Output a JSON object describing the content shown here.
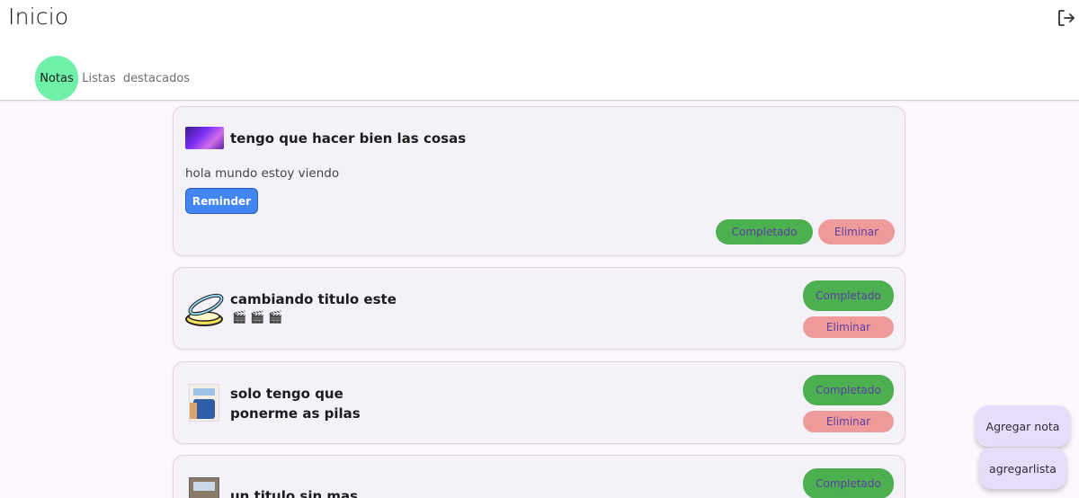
{
  "header": {
    "title": "Inicio",
    "tabs": [
      "Notas",
      "Listas",
      "destacados"
    ]
  },
  "notes": [
    {
      "title": "tengo que hacer bien las cosas",
      "body": "hola mundo estoy viendo",
      "reminder_label": "Reminder",
      "complete_label": "Completado",
      "delete_label": "Eliminar"
    },
    {
      "title": "cambiando titulo este",
      "emojis": "🎬🎬🎬",
      "complete_label": "Completado",
      "delete_label": "Eliminar"
    },
    {
      "title_line1": "solo tengo que",
      "title_line2": "ponerme as pilas",
      "complete_label": "Completado",
      "delete_label": "Eliminar"
    },
    {
      "title": "un titulo sin mas",
      "complete_label": "Completado"
    }
  ],
  "fab": {
    "add_note": "Agregar nota",
    "add_list": "agregarlista"
  },
  "colors": {
    "tab_active": "#6ff0a9",
    "complete": "#4caf50",
    "delete": "#ef9a9a",
    "reminder": "#4285f4",
    "fab": "#e8dcfb"
  }
}
